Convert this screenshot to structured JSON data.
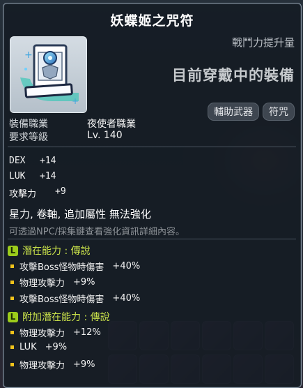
{
  "item": {
    "name": "妖蝶姬之咒符",
    "stat_increase_label": "戰鬥力提升量",
    "equipped_label": "目前穿戴中的裝備",
    "tags": [
      "輔助武器",
      "符咒"
    ],
    "job_label": "裝備職業",
    "job_value": "夜使者職業",
    "level_label": "要求等級",
    "level_value": "Lv. 140"
  },
  "stats": [
    {
      "name": "DEX",
      "value": "+14"
    },
    {
      "name": "LUK",
      "value": "+14"
    },
    {
      "name": "攻擊力",
      "value": "+9"
    }
  ],
  "properties": "星力, 卷軸, 追加屬性 無法強化",
  "hint": "可透過NPC/採集鍵查看強化資訊詳細內容。",
  "potential": {
    "grade": "L",
    "title": "潛在能力 : 傳說",
    "lines": [
      {
        "name": "攻擊Boss怪物時傷害",
        "value": "+40%"
      },
      {
        "name": "物理攻擊力",
        "value": "+9%"
      },
      {
        "name": "攻擊Boss怪物時傷害",
        "value": "+40%"
      }
    ]
  },
  "bonus_potential": {
    "grade": "L",
    "title": "附加潛在能力 : 傳說",
    "lines": [
      {
        "name": "物理攻擊力",
        "value": "+12%"
      },
      {
        "name": "LUK",
        "value": "+9%"
      },
      {
        "name": "物理攻擊力",
        "value": "+9%"
      }
    ]
  },
  "colors": {
    "potential_title": "#c9e14a",
    "bullet": "#f0c21b",
    "grade_badge": "#9ccc1b"
  },
  "icons": {
    "item_icon": "talisman-icon"
  }
}
